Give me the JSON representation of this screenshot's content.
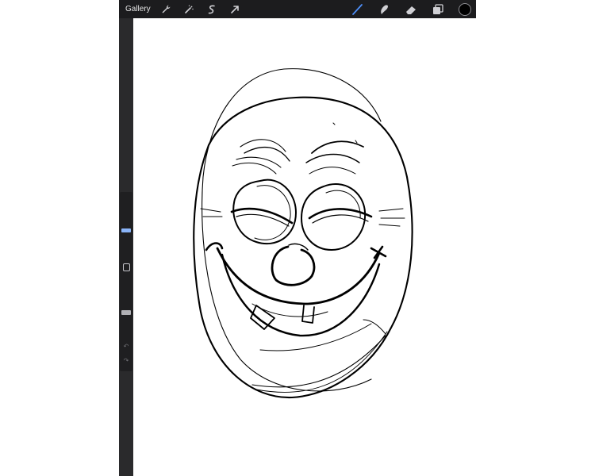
{
  "toolbar": {
    "gallery_label": "Gallery",
    "left_tools": [
      "wrench-icon",
      "magic-wand-icon",
      "selection-icon",
      "transform-arrow-icon"
    ],
    "right_tools": [
      "brush-icon",
      "smudge-icon",
      "eraser-icon",
      "layers-icon"
    ],
    "active_tool": "brush-icon",
    "active_tool_color": "#4d8ef7",
    "current_color": "#000000"
  },
  "sidebar": {
    "brush_size_level": 0.5,
    "opacity_level": 0.5,
    "accent": "#8ab4f8"
  }
}
